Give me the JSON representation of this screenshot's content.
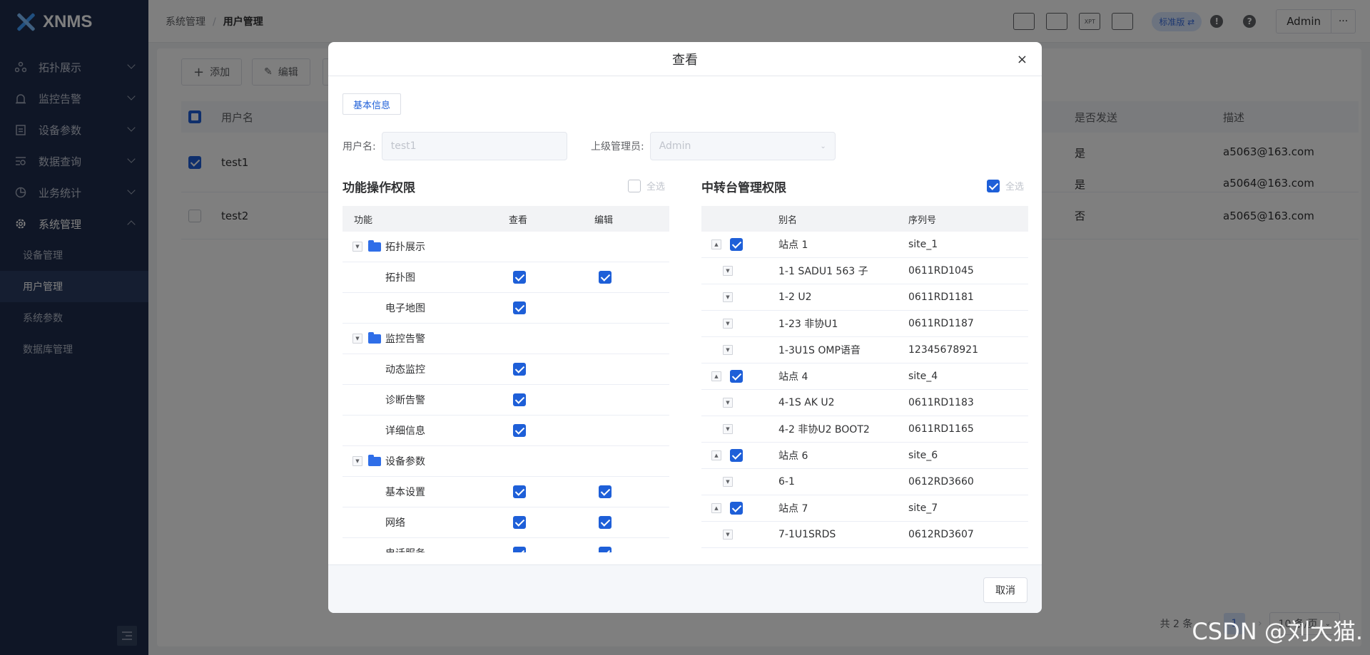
{
  "app": {
    "logo_text": "XNMS"
  },
  "sidebar": {
    "items": [
      {
        "label": "拓扑展示",
        "icon": "topology-icon"
      },
      {
        "label": "监控告警",
        "icon": "alarm-icon"
      },
      {
        "label": "设备参数",
        "icon": "clipboard-icon"
      },
      {
        "label": "数据查询",
        "icon": "data-query-icon"
      },
      {
        "label": "业务统计",
        "icon": "pie-chart-icon"
      },
      {
        "label": "系统管理",
        "icon": "gear-icon"
      }
    ],
    "sub_items": [
      {
        "label": "设备管理"
      },
      {
        "label": "用户管理"
      },
      {
        "label": "系统参数"
      },
      {
        "label": "数据库管理"
      }
    ]
  },
  "header": {
    "breadcrumb": [
      "系统管理",
      "用户管理"
    ],
    "badge": "标准版 ⇄",
    "user": "Admin",
    "xpt_label": "XPT"
  },
  "toolbar": {
    "add_label": "添加",
    "edit_label": "编辑"
  },
  "bg_table": {
    "headers": {
      "username": "用户名",
      "send": "是否发送",
      "desc": "描述"
    },
    "rows": [
      {
        "username": "test1",
        "send": [
          "是",
          "是"
        ],
        "desc": [
          "a5063@163.com",
          "a5064@163.com"
        ]
      },
      {
        "username": "test2",
        "send": [
          "否"
        ],
        "desc": [
          "a5065@163.com"
        ]
      }
    ]
  },
  "pagination": {
    "total": "共 2 条",
    "page": "1",
    "size": "10 条/页"
  },
  "modal": {
    "title": "查看",
    "tab": "基本信息",
    "username_label": "用户名:",
    "username_value": "test1",
    "manager_label": "上级管理员:",
    "manager_value": "Admin",
    "func_title": "功能操作权限",
    "relay_title": "中转台管理权限",
    "select_all": "全选",
    "func_headers": {
      "func": "功能",
      "view": "查看",
      "edit": "编辑"
    },
    "func_rows": [
      {
        "type": "group",
        "label": "拓扑展示"
      },
      {
        "type": "item",
        "label": "拓扑图",
        "view": true,
        "edit": true
      },
      {
        "type": "item",
        "label": "电子地图",
        "view": true,
        "edit": false
      },
      {
        "type": "group",
        "label": "监控告警"
      },
      {
        "type": "item",
        "label": "动态监控",
        "view": true,
        "edit": false
      },
      {
        "type": "item",
        "label": "诊断告警",
        "view": true,
        "edit": false
      },
      {
        "type": "item",
        "label": "详细信息",
        "view": true,
        "edit": false
      },
      {
        "type": "group",
        "label": "设备参数"
      },
      {
        "type": "item",
        "label": "基本设置",
        "view": true,
        "edit": true
      },
      {
        "type": "item",
        "label": "网络",
        "view": true,
        "edit": true
      },
      {
        "type": "item",
        "label": "电话服务",
        "view": true,
        "edit": true
      }
    ],
    "relay_headers": {
      "alias": "别名",
      "serial": "序列号"
    },
    "relay_rows": [
      {
        "type": "site",
        "alias": "站点 1",
        "serial": "site_1"
      },
      {
        "type": "dev",
        "alias": "1-1 SADU1 563 子",
        "serial": "0611RD1045"
      },
      {
        "type": "dev",
        "alias": "1-2 U2",
        "serial": "0611RD1181"
      },
      {
        "type": "dev",
        "alias": "1-23 非协U1",
        "serial": "0611RD1187"
      },
      {
        "type": "dev",
        "alias": "1-3U1S OMP语音",
        "serial": "12345678921"
      },
      {
        "type": "site",
        "alias": "站点 4",
        "serial": "site_4"
      },
      {
        "type": "dev",
        "alias": "4-1S AK U2",
        "serial": "0611RD1183"
      },
      {
        "type": "dev",
        "alias": "4-2 非协U2 BOOT2",
        "serial": "0611RD1165"
      },
      {
        "type": "site",
        "alias": "站点 6",
        "serial": "site_6"
      },
      {
        "type": "dev",
        "alias": "6-1",
        "serial": "0612RD3660"
      },
      {
        "type": "site",
        "alias": "站点 7",
        "serial": "site_7"
      },
      {
        "type": "dev",
        "alias": "7-1U1SRDS",
        "serial": "0612RD3607"
      }
    ],
    "cancel_label": "取消"
  },
  "watermark": "CSDN @刘大猫."
}
